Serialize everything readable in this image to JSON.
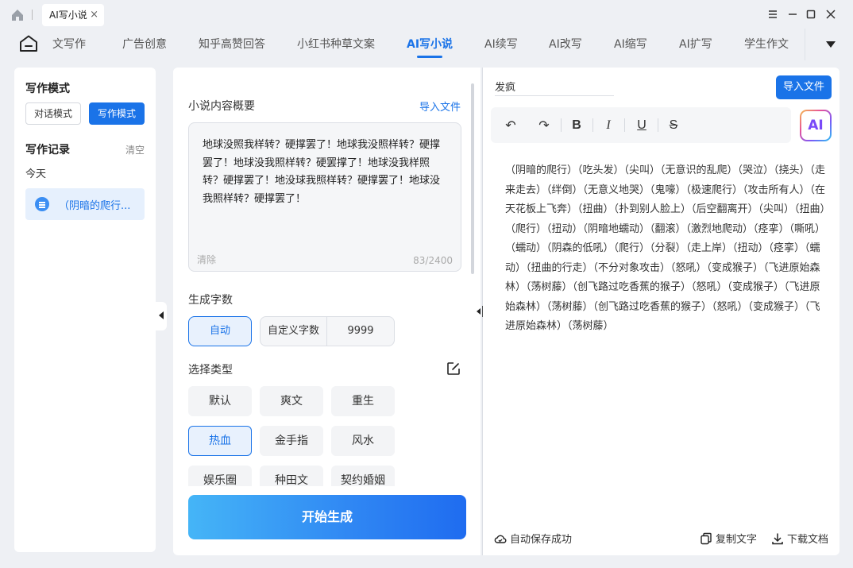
{
  "titlebar": {
    "tab_label": "AI写小说",
    "tab_close": "×"
  },
  "nav": {
    "items": [
      {
        "label": "文写作"
      },
      {
        "label": "广告创意"
      },
      {
        "label": "知乎高赞回答"
      },
      {
        "label": "小红书种草文案"
      },
      {
        "label": "AI写小说"
      },
      {
        "label": "AI续写"
      },
      {
        "label": "AI改写"
      },
      {
        "label": "AI缩写"
      },
      {
        "label": "AI扩写"
      },
      {
        "label": "学生作文"
      }
    ],
    "active": "AI写小说"
  },
  "left": {
    "mode_title": "写作模式",
    "mode_dialog": "对话模式",
    "mode_write": "写作模式",
    "record_title": "写作记录",
    "record_clear": "清空",
    "today": "今天",
    "record_item": "（阴暗的爬行..."
  },
  "middle": {
    "summary_label": "小说内容概要",
    "import_link": "导入文件",
    "summary_text": "地球没照我样转？硬撑罢了！地球我没照样转？硬撑罢了！地球没我照样转？硬罢撑了！地球没我样照转？硬撑罢了！地没球我照样转？硬撑罢了！地球没我照样转？硬撑罢了！",
    "summary_clear": "清除",
    "summary_count": "83/2400",
    "wordcount_label": "生成字数",
    "auto_btn": "自动",
    "custom_label": "自定义字数",
    "custom_value": "9999",
    "type_label": "选择类型",
    "types": [
      {
        "label": "默认"
      },
      {
        "label": "爽文"
      },
      {
        "label": "重生"
      },
      {
        "label": "热血"
      },
      {
        "label": "金手指"
      },
      {
        "label": "风水"
      },
      {
        "label": "娱乐圈"
      },
      {
        "label": "种田文"
      },
      {
        "label": "契约婚姻"
      }
    ],
    "active_type": "热血",
    "generate_btn": "开始生成"
  },
  "right": {
    "doc_title": "发疯",
    "import_btn": "导入文件",
    "toolbar": {
      "undo": "↶",
      "redo": "↷",
      "bold": "B",
      "italic": "I",
      "underline": "U",
      "strike": "S"
    },
    "ai_badge": "AI",
    "content": "（阴暗的爬行）（吃头发）（尖叫）（无意识的乱爬）（哭泣）（挠头）（走来走去）（绊倒）（无意义地哭）（鬼嚎）（极速爬行）（攻击所有人）（在天花板上飞奔）（扭曲）（扑到别人脸上）（后空翻离开）（尖叫）（扭曲）（爬行）（扭动）（阴暗地蠕动）（翻滚）（激烈地爬动）（痉挛）（嘶吼）（蠕动）（阴森的低吼）（爬行）（分裂）（走上岸）（扭动）（痉挛）（蠕动）（扭曲的行走）（不分对象攻击）（怒吼）（变成猴子）（飞进原始森林）（荡树藤）（创飞路过吃香蕉的猴子）（怒吼）（变成猴子）（飞进原始森林）（荡树藤）（创飞路过吃香蕉的猴子）（怒吼）（变成猴子）（飞进原始森林）（荡树藤）",
    "autosave": "自动保存成功",
    "copy": "复制文字",
    "download": "下载文档"
  },
  "colors": {
    "accent": "#1a73e8",
    "background": "#eef0f4"
  }
}
